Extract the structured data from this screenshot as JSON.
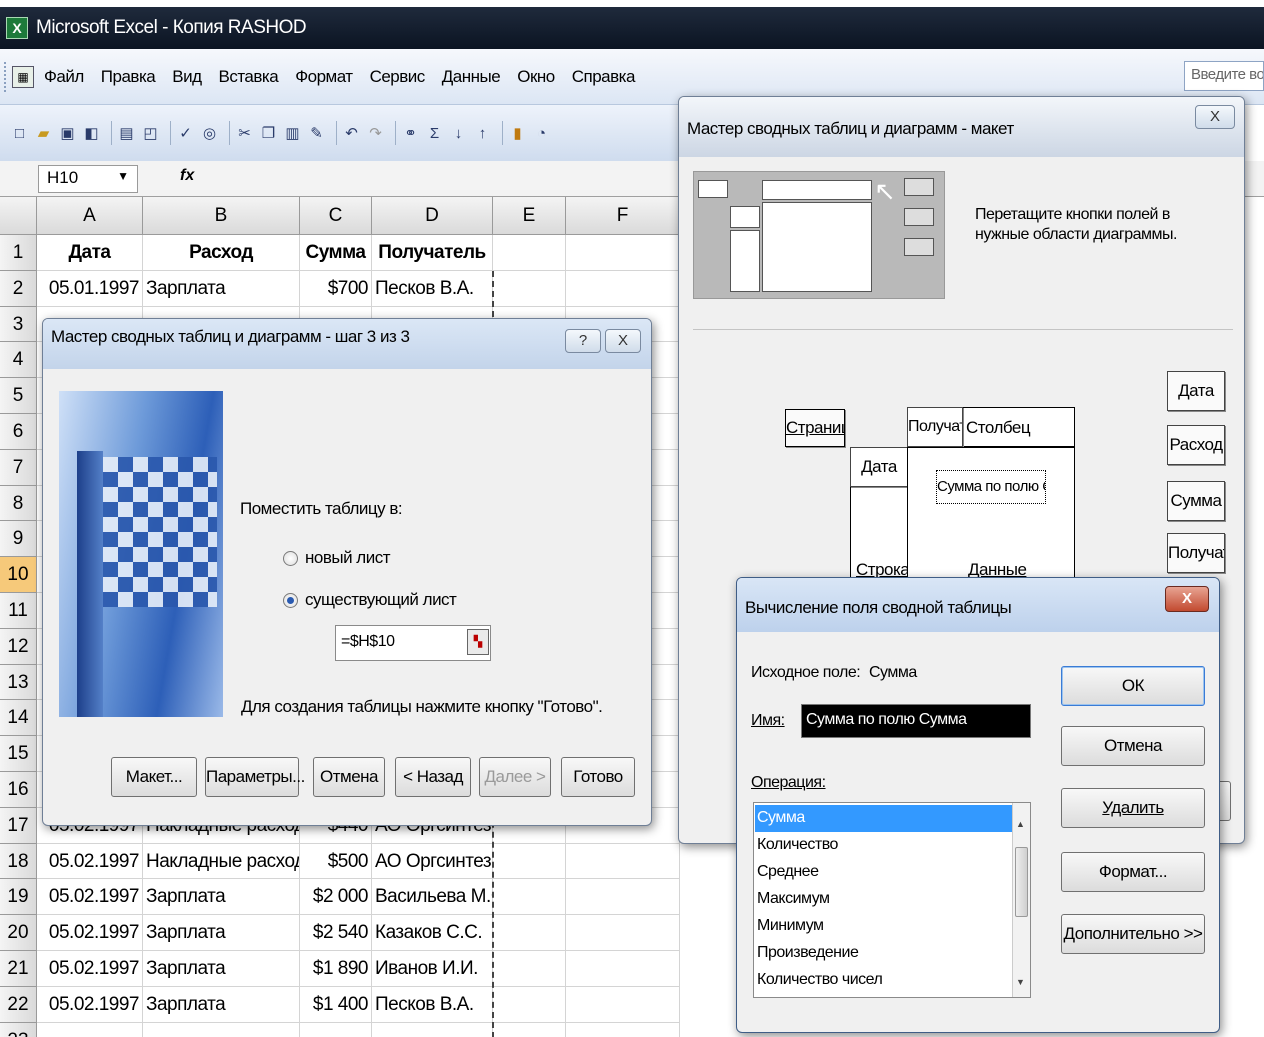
{
  "window": {
    "title": "Microsoft Excel - Копия RASHOD",
    "app_icon": "excel-icon"
  },
  "menu": {
    "items": [
      "Файл",
      "Правка",
      "Вид",
      "Вставка",
      "Формат",
      "Сервис",
      "Данные",
      "Окно",
      "Справка"
    ],
    "help_placeholder": "Введите вопрос"
  },
  "toolbar": {
    "icons": [
      "new-icon",
      "open-icon",
      "save-icon",
      "permission-icon",
      "print-icon",
      "print-preview-icon",
      "spelling-icon",
      "research-icon",
      "cut-icon",
      "copy-icon",
      "paste-icon",
      "format-painter-icon",
      "undo-icon",
      "redo-icon",
      "hyperlink-icon",
      "autosum-icon",
      "sort-asc-icon",
      "sort-desc-icon",
      "chart-wizard-icon",
      "help-icon"
    ]
  },
  "formula_bar": {
    "name_box": "H10",
    "fx": "fx",
    "formula": ""
  },
  "sheet": {
    "columns": [
      "A",
      "B",
      "C",
      "D",
      "E",
      "F"
    ],
    "header_row": {
      "num": "1",
      "cells": [
        "Дата",
        "Расход",
        "Сумма",
        "Получатель",
        "",
        ""
      ]
    },
    "rows": [
      {
        "num": "2",
        "cells": [
          "05.01.1997",
          "Зарплата",
          "$700",
          "Песков В.А."
        ]
      },
      {
        "num": "3",
        "cells": [
          "",
          "",
          "",
          ""
        ]
      },
      {
        "num": "4",
        "cells": [
          "",
          "",
          "",
          ""
        ]
      },
      {
        "num": "5",
        "cells": [
          "",
          "",
          "",
          ""
        ]
      },
      {
        "num": "6",
        "cells": [
          "",
          "",
          "",
          ""
        ]
      },
      {
        "num": "7",
        "cells": [
          "",
          "",
          "",
          ""
        ]
      },
      {
        "num": "8",
        "cells": [
          "",
          "",
          "",
          ""
        ]
      },
      {
        "num": "9",
        "cells": [
          "",
          "",
          "",
          ""
        ]
      },
      {
        "num": "10",
        "cells": [
          "",
          "",
          "",
          ""
        ]
      },
      {
        "num": "11",
        "cells": [
          "",
          "",
          "",
          ""
        ]
      },
      {
        "num": "12",
        "cells": [
          "",
          "",
          "",
          ""
        ]
      },
      {
        "num": "13",
        "cells": [
          "",
          "",
          "",
          ""
        ]
      },
      {
        "num": "14",
        "cells": [
          "",
          "",
          "",
          ""
        ]
      },
      {
        "num": "15",
        "cells": [
          "",
          "",
          "",
          ""
        ]
      },
      {
        "num": "16",
        "cells": [
          "",
          "",
          "",
          ""
        ]
      },
      {
        "num": "17",
        "cells": [
          "05.02.1997",
          "Накладные расходы",
          "$440",
          "АО Оргсинтез"
        ]
      },
      {
        "num": "18",
        "cells": [
          "05.02.1997",
          "Накладные расходы",
          "$500",
          "АО Оргсинтез"
        ]
      },
      {
        "num": "19",
        "cells": [
          "05.02.1997",
          "Зарплата",
          "$2 000",
          "Васильева М.Ф."
        ]
      },
      {
        "num": "20",
        "cells": [
          "05.02.1997",
          "Зарплата",
          "$2 540",
          "Казаков С.С."
        ]
      },
      {
        "num": "21",
        "cells": [
          "05.02.1997",
          "Зарплата",
          "$1 890",
          "Иванов И.И."
        ]
      },
      {
        "num": "22",
        "cells": [
          "05.02.1997",
          "Зарплата",
          "$1 400",
          "Песков В.А."
        ]
      },
      {
        "num": "23",
        "cells": [
          "",
          "",
          "",
          ""
        ]
      }
    ],
    "selected_row": "10"
  },
  "wizard3": {
    "title": "Мастер сводных таблиц и диаграмм - шаг 3 из 3",
    "help_btn": "?",
    "close_btn": "X",
    "place_label": "Поместить таблицу в:",
    "radio_new": "новый лист",
    "radio_existing": "существующий лист",
    "selected": "existing",
    "range_value": "=$H$10",
    "hint": "Для создания таблицы нажмите кнопку \"Готово\".",
    "buttons": {
      "layout": "Макет...",
      "params": "Параметры...",
      "cancel": "Отмена",
      "back": "< Назад",
      "next": "Далее >",
      "finish": "Готово"
    }
  },
  "layout_dialog": {
    "title": "Мастер сводных таблиц и диаграмм - макет",
    "close_btn": "X",
    "instruction": "Перетащите кнопки полей в нужные области диаграммы.",
    "areas": {
      "page": "Страница",
      "column_field": "Получатель",
      "column": "Столбец",
      "row_field": "Дата",
      "row": "Строка",
      "data_field": "Сумма по полю Сумма",
      "data": "Данные"
    },
    "fields": [
      "Дата",
      "Расход",
      "Сумма",
      "Получатель"
    ]
  },
  "calc_dialog": {
    "title": "Вычисление поля сводной таблицы",
    "close_btn": "X",
    "source_label": "Исходное поле:",
    "source_value": "Сумма",
    "name_label": "Имя:",
    "name_value": "Сумма по полю Сумма",
    "operation_label": "Операция:",
    "operations": [
      "Сумма",
      "Количество",
      "Среднее",
      "Максимум",
      "Минимум",
      "Произведение",
      "Количество чисел"
    ],
    "selected_operation": "Сумма",
    "buttons": {
      "ok": "ОК",
      "cancel": "Отмена",
      "delete": "Удалить",
      "format": "Формат...",
      "more": "Дополнительно >>"
    }
  }
}
